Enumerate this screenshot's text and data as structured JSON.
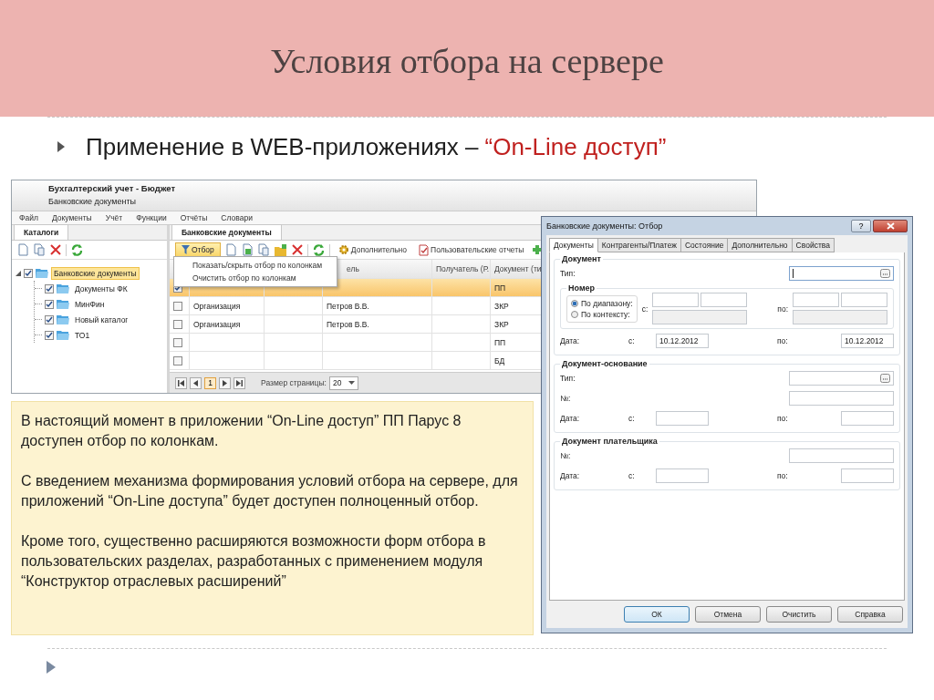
{
  "slide_title": "Условия отбора на сервере",
  "subtitle": {
    "text": "Применение в WEB-приложениях –",
    "highlight": "“On-Line доступ”"
  },
  "app": {
    "title": "Бухгалтерский учет - Бюджет",
    "subtitle": "Банковские документы",
    "menu": [
      "Файл",
      "Документы",
      "Учёт",
      "Функции",
      "Отчёты",
      "Словари"
    ],
    "left_tab": {
      "label": "Каталоги",
      "selected": true
    },
    "tree": [
      {
        "label": "Банковские документы",
        "checked": true,
        "selected": true,
        "expanded": true,
        "children": [
          {
            "label": "Документы ФК",
            "checked": true,
            "selected": false
          },
          {
            "label": "МинФин",
            "checked": true,
            "selected": false
          },
          {
            "label": "Новый каталог",
            "checked": true,
            "selected": false
          },
          {
            "label": "ТО1",
            "checked": true,
            "selected": false
          }
        ]
      }
    ],
    "right_tab": {
      "label": "Банковские документы",
      "selected": true
    },
    "toolbar": {
      "filter_button": "Отбор",
      "filter_open": true,
      "extra_button": "Дополнительно",
      "reports_button": "Пользовательские отчеты"
    },
    "filter_menu": [
      "Показать/скрыть отбор по колонкам",
      "Очистить отбор по колонкам"
    ],
    "table": {
      "header": {
        "column_4": "ель",
        "column_5": "Получатель (Р.",
        "column_6": "Документ (ти"
      },
      "rows": [
        {
          "selected": true,
          "checked": true,
          "cells": {
            "column_6": "ПП"
          }
        },
        {
          "selected": false,
          "checked": false,
          "cells": {
            "column_2": "Организация",
            "column_4": "Петров В.В.",
            "column_6": "ЗКР"
          }
        },
        {
          "selected": false,
          "checked": false,
          "cells": {
            "column_2": "Организация",
            "column_4": "Петров В.В.",
            "column_6": "ЗКР"
          }
        },
        {
          "selected": false,
          "checked": false,
          "cells": {
            "column_6": "ПП"
          }
        },
        {
          "selected": false,
          "checked": false,
          "cells": {
            "column_6": "БД"
          }
        }
      ]
    },
    "pager": {
      "pages": [
        {
          "label": "1",
          "selected": true
        }
      ],
      "size_label": "Размер страницы:",
      "size_value": "20"
    }
  },
  "dialog": {
    "title": "Банковские документы: Отбор",
    "help": "?",
    "tabs": [
      {
        "label": "Документы",
        "selected": true
      },
      {
        "label": "Контрагенты/Платеж",
        "selected": false
      },
      {
        "label": "Состояние",
        "selected": false
      },
      {
        "label": "Дополнительно",
        "selected": false
      },
      {
        "label": "Свойства",
        "selected": false
      }
    ],
    "document": {
      "title": "Документ",
      "type_label": "Тип:",
      "number": {
        "title": "Номер",
        "options": [
          {
            "label": "По диапазону:",
            "selected": true
          },
          {
            "label": "По контексту:",
            "selected": false
          }
        ],
        "from_label": "с:",
        "to_label": "по:",
        "context_disabled": true
      },
      "date_label": "Дата:",
      "from_label": "с:",
      "date_from": "10.12.2012",
      "to_label": "по:",
      "date_to": "10.12.2012"
    },
    "basis": {
      "title": "Документ-основание",
      "type_label": "Тип:",
      "number_label": "№:",
      "date_label": "Дата:",
      "from_label": "с:",
      "to_label": "по:"
    },
    "payer": {
      "title": "Документ плательщика",
      "number_label": "№:",
      "date_label": "Дата:",
      "from_label": "с:",
      "to_label": "по:"
    },
    "buttons": [
      {
        "label": "ОК",
        "default": true
      },
      {
        "label": "Отмена",
        "default": false
      },
      {
        "label": "Очистить",
        "default": false
      },
      {
        "label": "Справка",
        "default": false
      }
    ]
  },
  "note": {
    "paragraphs": [
      "В настоящий момент в приложении “On-Line доступ” ПП Парус 8 доступен отбор по колонкам.",
      "С введением механизма формирования условий отбора на сервере, для приложений “On-Line доступа” будет доступен полноценный отбор.",
      "Кроме того, существенно расширяются возможности форм отбора в пользовательских разделах, разработанных с применением модуля “Конструктор отраслевых расширений”"
    ]
  }
}
